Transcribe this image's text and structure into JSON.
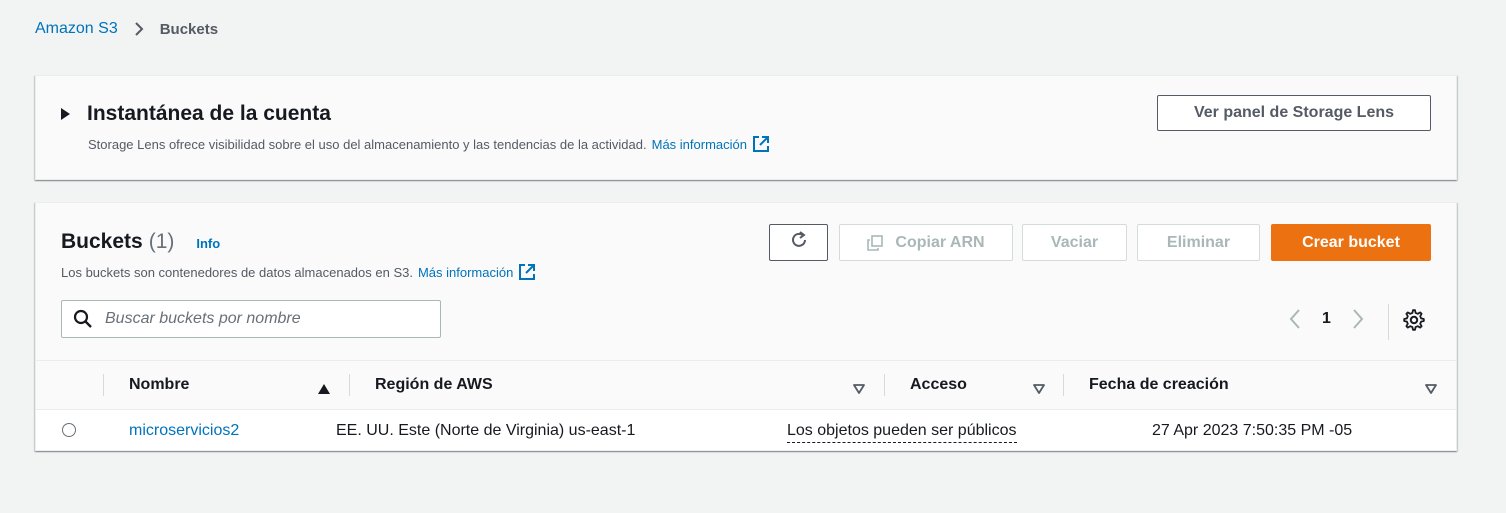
{
  "breadcrumb": {
    "root": "Amazon S3",
    "current": "Buckets"
  },
  "snapshot": {
    "title": "Instantánea de la cuenta",
    "description": "Storage Lens ofrece visibilidad sobre el uso del almacenamiento y las tendencias de la actividad.",
    "more_info": "Más información",
    "button": "Ver panel de Storage Lens"
  },
  "buckets": {
    "title": "Buckets",
    "count": "(1)",
    "info": "Info",
    "description": "Los buckets son contenedores de datos almacenados en S3.",
    "more_info": "Más información",
    "actions": {
      "copy_arn": "Copiar ARN",
      "empty": "Vaciar",
      "delete": "Eliminar",
      "create": "Crear bucket"
    },
    "search_placeholder": "Buscar buckets por nombre",
    "page": "1",
    "columns": {
      "name": "Nombre",
      "region": "Región de AWS",
      "access": "Acceso",
      "created": "Fecha de creación"
    },
    "rows": [
      {
        "name": "microservicios2",
        "region": "EE. UU. Este (Norte de Virginia) us-east-1",
        "access": "Los objetos pueden ser públicos",
        "created": "27 Apr 2023 7:50:35 PM -05"
      }
    ]
  },
  "colors": {
    "link": "#0073bb",
    "primary": "#ec7211",
    "text": "#16191f",
    "muted": "#545b64"
  },
  "icons": [
    "chevron-right-icon",
    "caret-right-icon",
    "external-link-icon",
    "refresh-icon",
    "copy-icon",
    "search-icon",
    "chevron-left-icon",
    "settings-gear-icon",
    "sort-ascending-icon",
    "sort-descending-icon"
  ]
}
